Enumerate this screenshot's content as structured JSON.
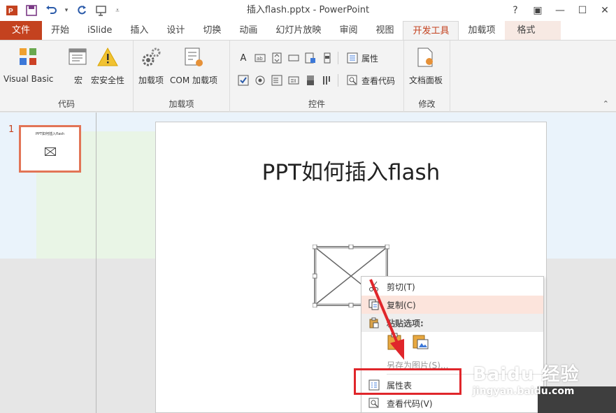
{
  "window": {
    "title": "插入flash.pptx - PowerPoint",
    "help": "?",
    "restore_ribbon": "▣",
    "minimize": "—",
    "maximize": "☐",
    "close": "✕"
  },
  "tabs": [
    {
      "label": "文件"
    },
    {
      "label": "开始"
    },
    {
      "label": "iSlide"
    },
    {
      "label": "插入"
    },
    {
      "label": "设计"
    },
    {
      "label": "切换"
    },
    {
      "label": "动画"
    },
    {
      "label": "幻灯片放映"
    },
    {
      "label": "审阅"
    },
    {
      "label": "视图"
    },
    {
      "label": "开发工具"
    },
    {
      "label": "加载项"
    },
    {
      "label": "格式"
    }
  ],
  "ribbon": {
    "code": {
      "label": "代码",
      "visual_basic": "Visual Basic",
      "macro": "宏",
      "macro_security": "宏安全性"
    },
    "addins": {
      "label": "加载项",
      "addin": "加载项",
      "com_addin": "COM 加载项"
    },
    "controls": {
      "label": "控件",
      "properties": "属性",
      "view_code": "查看代码",
      "label_a": "A"
    },
    "modify": {
      "label": "修改",
      "doc_panel": "文档面板"
    }
  },
  "thumbnail": {
    "number": "1",
    "title": "PPT如何插入flash"
  },
  "slide": {
    "title": "PPT如何插入flash"
  },
  "context_menu": {
    "cut": "剪切(T)",
    "copy": "复制(C)",
    "paste_options": "粘贴选项:",
    "save_as_picture": "另存为图片(S)...",
    "property_sheet": "属性表",
    "view_code": "查看代码(V)"
  },
  "watermark": {
    "brand": "Baidu 经验",
    "url": "jingyan.baidu.com"
  },
  "colors": {
    "accent": "#c4421f",
    "highlight_box": "#e0262b"
  }
}
